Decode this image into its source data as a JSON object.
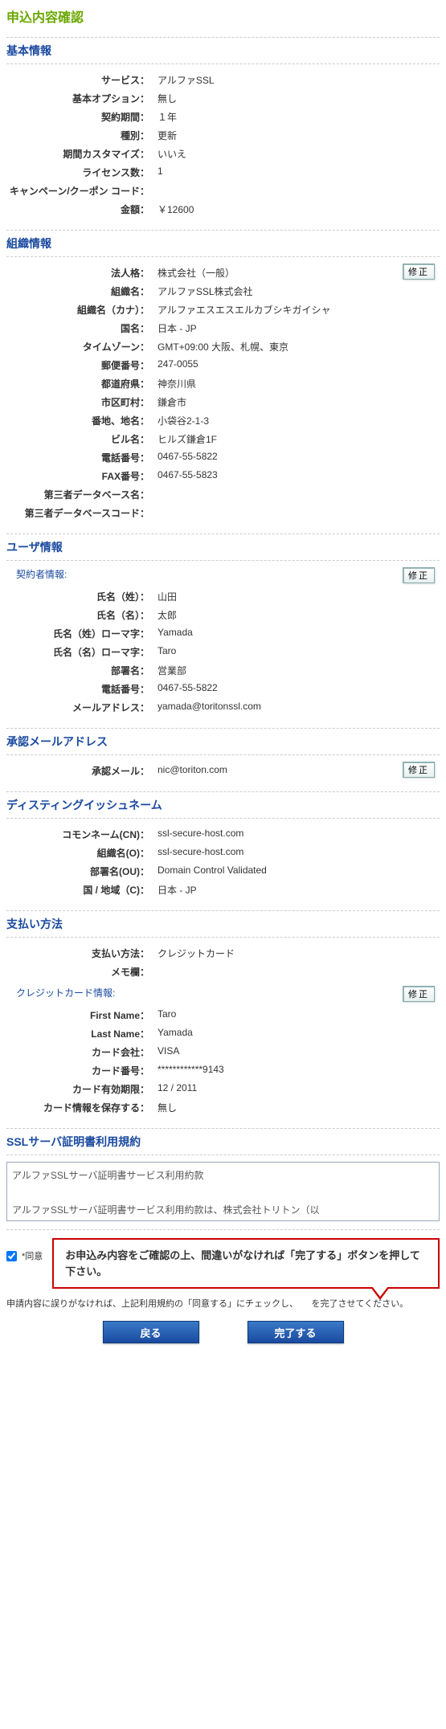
{
  "title": "申込内容確認",
  "edit_label": "修正",
  "basic": {
    "title": "基本情報",
    "rows": [
      {
        "l": "サービス：",
        "v": "アルファSSL"
      },
      {
        "l": "基本オプション：",
        "v": "無し"
      },
      {
        "l": "契約期間：",
        "v": "１年"
      },
      {
        "l": "種別：",
        "v": "更新"
      },
      {
        "l": "期間カスタマイズ：",
        "v": "いいえ"
      },
      {
        "l": "ライセンス数：",
        "v": "1"
      },
      {
        "l": "キャンペーン/クーポン コード：",
        "v": ""
      },
      {
        "l": "金額：",
        "v": "￥12600"
      }
    ]
  },
  "org": {
    "title": "組織情報",
    "rows": [
      {
        "l": "法人格：",
        "v": "株式会社（一般）"
      },
      {
        "l": "組織名：",
        "v": "アルファSSL株式会社"
      },
      {
        "l": "組織名（カナ）：",
        "v": "アルファエスエスエルカブシキガイシャ"
      },
      {
        "l": "国名：",
        "v": "日本 - JP"
      },
      {
        "l": "タイムゾーン：",
        "v": "GMT+09:00 大阪、札幌、東京"
      },
      {
        "l": "郵便番号：",
        "v": "247-0055"
      },
      {
        "l": "都道府県：",
        "v": "神奈川県"
      },
      {
        "l": "市区町村：",
        "v": "鎌倉市"
      },
      {
        "l": "番地、地名：",
        "v": "小袋谷2-1-3"
      },
      {
        "l": "ビル名：",
        "v": "ヒルズ鎌倉1F"
      },
      {
        "l": "電話番号：",
        "v": "0467-55-5822"
      },
      {
        "l": "FAX番号：",
        "v": "0467-55-5823"
      },
      {
        "l": "第三者データベース名：",
        "v": ""
      },
      {
        "l": "第三者データベースコード：",
        "v": ""
      }
    ]
  },
  "user": {
    "title": "ユーザ情報",
    "sub": "契約者情報:",
    "rows": [
      {
        "l": "氏名（姓）：",
        "v": "山田"
      },
      {
        "l": "氏名（名）：",
        "v": "太郎"
      },
      {
        "l": "氏名（姓）ローマ字：",
        "v": "Yamada"
      },
      {
        "l": "氏名（名）ローマ字：",
        "v": "Taro"
      },
      {
        "l": "部署名：",
        "v": "営業部"
      },
      {
        "l": "電話番号：",
        "v": "0467-55-5822"
      },
      {
        "l": "メールアドレス：",
        "v": "yamada@toritonssl.com"
      }
    ]
  },
  "approve": {
    "title": "承認メールアドレス",
    "rows": [
      {
        "l": "承認メール：",
        "v": "nic@toriton.com"
      }
    ]
  },
  "dn": {
    "title": "ディスティングイッシュネーム",
    "rows": [
      {
        "l": "コモンネーム(CN)：",
        "v": "ssl-secure-host.com"
      },
      {
        "l": "組織名(O)：",
        "v": "ssl-secure-host.com"
      },
      {
        "l": "部署名(OU)：",
        "v": "Domain Control Validated"
      },
      {
        "l": "国 / 地域（C)：",
        "v": "日本 - JP"
      }
    ]
  },
  "pay": {
    "title": "支払い方法",
    "rows": [
      {
        "l": "支払い方法：",
        "v": "クレジットカード"
      },
      {
        "l": "メモ欄：",
        "v": ""
      }
    ],
    "sub": "クレジットカード情報:",
    "rows2": [
      {
        "l": "First Name：",
        "v": "Taro"
      },
      {
        "l": "Last Name：",
        "v": "Yamada"
      },
      {
        "l": "カード会社：",
        "v": "VISA"
      },
      {
        "l": "カード番号：",
        "v": "************9143"
      },
      {
        "l": "カード有効期限：",
        "v": "12 / 2011"
      },
      {
        "l": "カード情報を保存する：",
        "v": "無し"
      }
    ]
  },
  "terms": {
    "title": "SSLサーバ証明書利用規約",
    "body_l1": "アルファSSLサーバ証明書サービス利用約款",
    "body_l2": "アルファSSLサーバ証明書サービス利用約款は、株式会社トリトン（以"
  },
  "agree_label": "*同意",
  "callout": "お申込み内容をご確認の上、間違いがなければ「完了する」ボタンを押して下さい。",
  "footnote": "申請内容に誤りがなければ、上記利用規約の「同意する」にチェックし、　　を完了させてください。",
  "back_btn": "戻る",
  "done_btn": "完了する"
}
